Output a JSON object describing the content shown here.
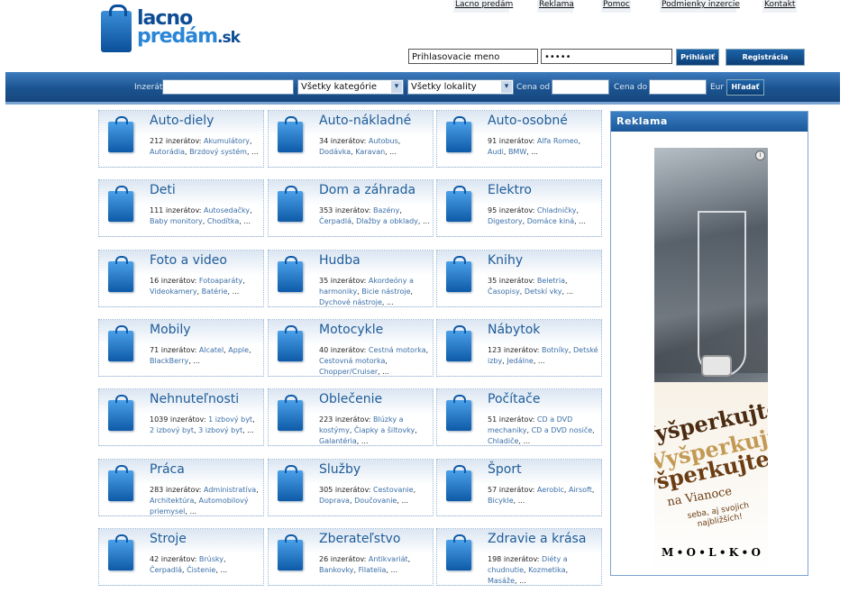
{
  "logo": {
    "line1": "lacno",
    "line2": "predám",
    "tld": ".sk"
  },
  "top_nav": [
    "Lacno predám",
    "Reklama",
    "Pomoc",
    "Podmienky inzercie",
    "Kontakt"
  ],
  "login": {
    "username_value": "Prihlasovacie meno",
    "password_value": "•••••",
    "login_label": "Prihlásiť",
    "register_label": "Registrácia zdarma"
  },
  "search": {
    "ad_label": "Inzerát",
    "ad_value": "",
    "category_selected": "Všetky kategórie",
    "location_selected": "Všetky lokality",
    "price_from_label": "Cena od",
    "price_to_label": "Cena do",
    "currency": "Eur",
    "search_label": "Hľadať"
  },
  "categories": [
    {
      "title": "Auto-diely",
      "count": "212 inzerátov:",
      "links": [
        "Akumulátory",
        "Autorádia",
        "Brzdový systém"
      ]
    },
    {
      "title": "Auto-nákladné",
      "count": "34 inzerátov:",
      "links": [
        "Autobus",
        "Dodávka",
        "Karavan"
      ]
    },
    {
      "title": "Auto-osobné",
      "count": "91 inzerátov:",
      "links": [
        "Alfa Romeo",
        "Audi",
        "BMW"
      ]
    },
    {
      "title": "Deti",
      "count": "111 inzerátov:",
      "links": [
        "Autosedačky",
        "Baby monitory",
        "Chodítka"
      ]
    },
    {
      "title": "Dom a záhrada",
      "count": "353 inzerátov:",
      "links": [
        "Bazény",
        "Čerpadlá",
        "Dlažby a obklady"
      ]
    },
    {
      "title": "Elektro",
      "count": "95 inzerátov:",
      "links": [
        "Chladničky",
        "Digestory",
        "Domáce kiná"
      ]
    },
    {
      "title": "Foto a video",
      "count": "16 inzerátov:",
      "links": [
        "Fotoaparáty",
        "Videokamery",
        "Batérie"
      ]
    },
    {
      "title": "Hudba",
      "count": "35 inzerátov:",
      "links": [
        "Akordeóny a harmoniky",
        "Bicie nástroje",
        "Dychové nástroje"
      ]
    },
    {
      "title": "Knihy",
      "count": "35 inzerátov:",
      "links": [
        "Beletria",
        "Časopisy",
        "Detskí vky"
      ]
    },
    {
      "title": "Mobily",
      "count": "71 inzerátov:",
      "links": [
        "Alcatel",
        "Apple",
        "BlackBerry"
      ]
    },
    {
      "title": "Motocykle",
      "count": "40 inzerátov:",
      "links": [
        "Cestná motorka",
        "Cestovná motorka",
        "Chopper/Cruiser"
      ]
    },
    {
      "title": "Nábytok",
      "count": "123 inzerátov:",
      "links": [
        "Botníky",
        "Detské izby",
        "Jedálne"
      ]
    },
    {
      "title": "Nehnuteľnosti",
      "count": "1039 inzerátov:",
      "links": [
        "1 izbový byt",
        "2 izbový byt",
        "3 izbový byt"
      ]
    },
    {
      "title": "Oblečenie",
      "count": "223 inzerátov:",
      "links": [
        "Blúzky a kostýmy",
        "Čiapky a šiltovky",
        "Galantéria"
      ]
    },
    {
      "title": "Počítače",
      "count": "51 inzerátov:",
      "links": [
        "CD a DVD mechaniky",
        "CD a DVD nosiče",
        "Chladiče"
      ]
    },
    {
      "title": "Práca",
      "count": "283 inzerátov:",
      "links": [
        "Administratíva",
        "Architektúra",
        "Automobilový priemysel"
      ]
    },
    {
      "title": "Služby",
      "count": "305 inzerátov:",
      "links": [
        "Cestovanie",
        "Doprava",
        "Doučovanie"
      ]
    },
    {
      "title": "Šport",
      "count": "57 inzerátov:",
      "links": [
        "Aerobic",
        "Airsoft",
        "Bicykle"
      ]
    },
    {
      "title": "Stroje",
      "count": "42 inzerátov:",
      "links": [
        "Brúsky",
        "Čerpadlá",
        "Čistenie"
      ]
    },
    {
      "title": "Zberateľstvo",
      "count": "26 inzerátov:",
      "links": [
        "Antikvariát",
        "Bankovky",
        "Filatelia"
      ]
    },
    {
      "title": "Zdravie a krása",
      "count": "198 inzerátov:",
      "links": [
        "Diéty a chudnutie",
        "Kozmetika",
        "Masáže"
      ]
    }
  ],
  "ellipsis": "...",
  "sidebar": {
    "title": "Reklama",
    "ad": {
      "words": [
        "Vyšperkujte",
        "Vyšperkujte",
        "Vyšperkujte"
      ],
      "na_vianoce": "na Vianoce",
      "tagline": "seba, aj svojich najbližších!",
      "brand_letters": [
        "M",
        "O",
        "L",
        "K",
        "O"
      ],
      "info": "i"
    }
  }
}
